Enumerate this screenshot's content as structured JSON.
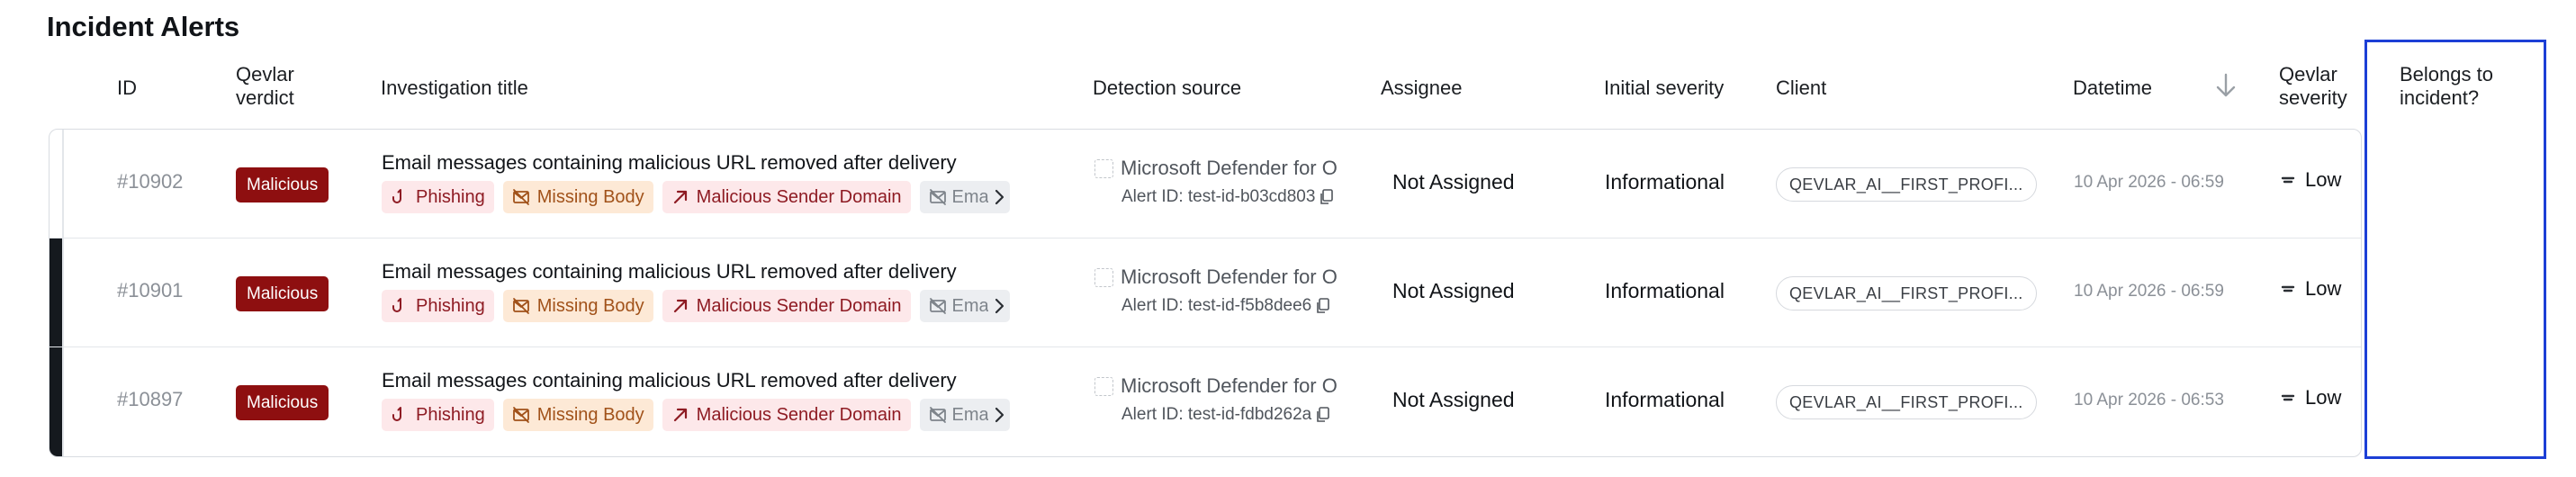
{
  "page": {
    "title": "Incident Alerts"
  },
  "columns": {
    "id": "ID",
    "verdict": "Qevlar verdict",
    "title": "Investigation title",
    "source": "Detection source",
    "assignee": "Assignee",
    "initial_severity": "Initial severity",
    "client": "Client",
    "datetime": "Datetime",
    "qevlar_severity": "Qevlar severity",
    "belongs": "Belongs to incident?"
  },
  "colors": {
    "malicious": "#8e0f10",
    "phishing_bg": "#fde8ea",
    "phishing_fg": "#8e1b23",
    "missing_bg": "#fde9d6",
    "missing_fg": "#a1521a",
    "sender_bg": "#fde8ea",
    "sender_fg": "#8e1b23",
    "highlight": "#1c3fd6"
  },
  "rows": [
    {
      "id": "#10902",
      "verdict": "Malicious",
      "title": "Email messages containing malicious URL removed after delivery",
      "tags": [
        "Phishing",
        "Missing Body",
        "Malicious Sender Domain"
      ],
      "more_tag": "Email",
      "source": "Microsoft Defender for O",
      "alert_id": "Alert ID: test-id-b03cd803",
      "assignee": "Not Assigned",
      "initial_severity": "Informational",
      "client": "QEVLAR_AI__FIRST_PROFI...",
      "datetime": "10 Apr 2026 - 06:59",
      "qevlar_severity": "Low",
      "belongs": true
    },
    {
      "id": "#10901",
      "verdict": "Malicious",
      "title": "Email messages containing malicious URL removed after delivery",
      "tags": [
        "Phishing",
        "Missing Body",
        "Malicious Sender Domain"
      ],
      "more_tag": "Email",
      "source": "Microsoft Defender for O",
      "alert_id": "Alert ID: test-id-f5b8dee6",
      "assignee": "Not Assigned",
      "initial_severity": "Informational",
      "client": "QEVLAR_AI__FIRST_PROFI...",
      "datetime": "10 Apr 2026 - 06:59",
      "qevlar_severity": "Low",
      "belongs": false
    },
    {
      "id": "#10897",
      "verdict": "Malicious",
      "title": "Email messages containing malicious URL removed after delivery",
      "tags": [
        "Phishing",
        "Missing Body",
        "Malicious Sender Domain"
      ],
      "more_tag": "Email",
      "source": "Microsoft Defender for O",
      "alert_id": "Alert ID: test-id-fdbd262a",
      "assignee": "Not Assigned",
      "initial_severity": "Informational",
      "client": "QEVLAR_AI__FIRST_PROFI...",
      "datetime": "10 Apr 2026 - 06:53",
      "qevlar_severity": "Low",
      "belongs": true
    }
  ]
}
